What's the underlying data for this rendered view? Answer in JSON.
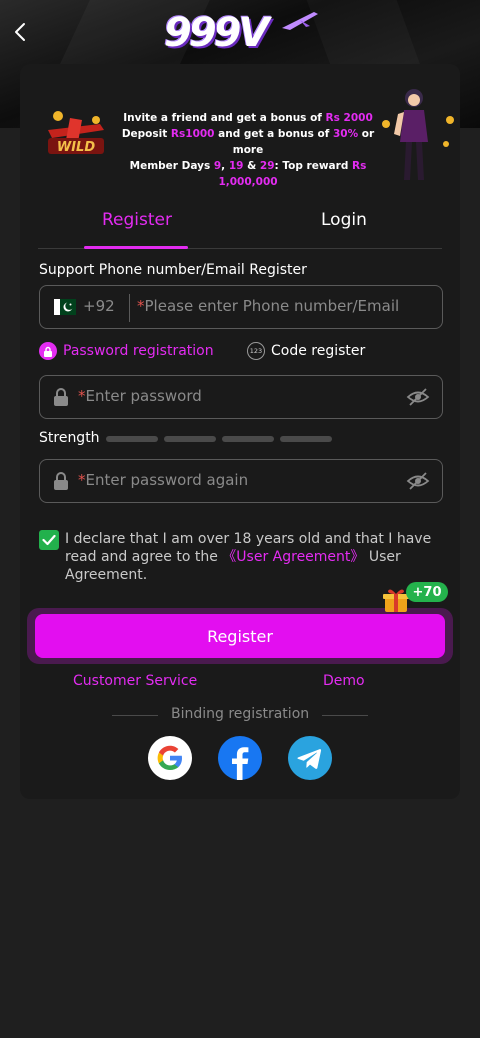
{
  "header": {
    "logo_text": "999V",
    "back_icon": "chevron-left-icon"
  },
  "promo": {
    "line1_pre": "Invite a friend and get a bonus of ",
    "line1_hl": "Rs 2000",
    "line2_pre": "Deposit ",
    "line2_hl1": "Rs1000",
    "line2_mid": " and get a bonus of ",
    "line2_hl2": "30%",
    "line2_post": " or more",
    "line3_pre": "Member Days ",
    "line3_hl1": "9",
    "line3_sep1": ", ",
    "line3_hl2": "19",
    "line3_sep2": " & ",
    "line3_hl3": "29",
    "line3_mid": ": Top reward ",
    "line3_hl4": "Rs 1,000,000",
    "wild_text": "WILD"
  },
  "tabs": {
    "register": "Register",
    "login": "Login",
    "active": "register"
  },
  "form": {
    "section_label": "Support Phone number/Email Register",
    "country_code": "+92",
    "phone_placeholder": "Please enter Phone number/Email",
    "required_mark": "*",
    "mode_password": "Password registration",
    "mode_code": "Code register",
    "mode_code_icon_text": "123",
    "password_placeholder": "Enter password",
    "strength_label": "Strength",
    "strength_level": 0,
    "password_again_placeholder": "Enter password again"
  },
  "agreement": {
    "checked": true,
    "text_pre": "I declare that I am over 18 years old and that I have read and agree to the ",
    "link": "《User Agreement》",
    "text_post": " User Agreement."
  },
  "register_button": {
    "label": "Register",
    "bonus_badge": "+70"
  },
  "links": {
    "customer_service": "Customer Service",
    "demo": "Demo"
  },
  "binding": {
    "label": "Binding registration",
    "providers": [
      "google",
      "facebook",
      "telegram"
    ]
  },
  "colors": {
    "accent": "#e32cf1",
    "button": "#e30ef0",
    "check": "#22b14c",
    "badge": "#24b24c",
    "background": "#1f1f1f",
    "card": "#1a1a1a"
  }
}
